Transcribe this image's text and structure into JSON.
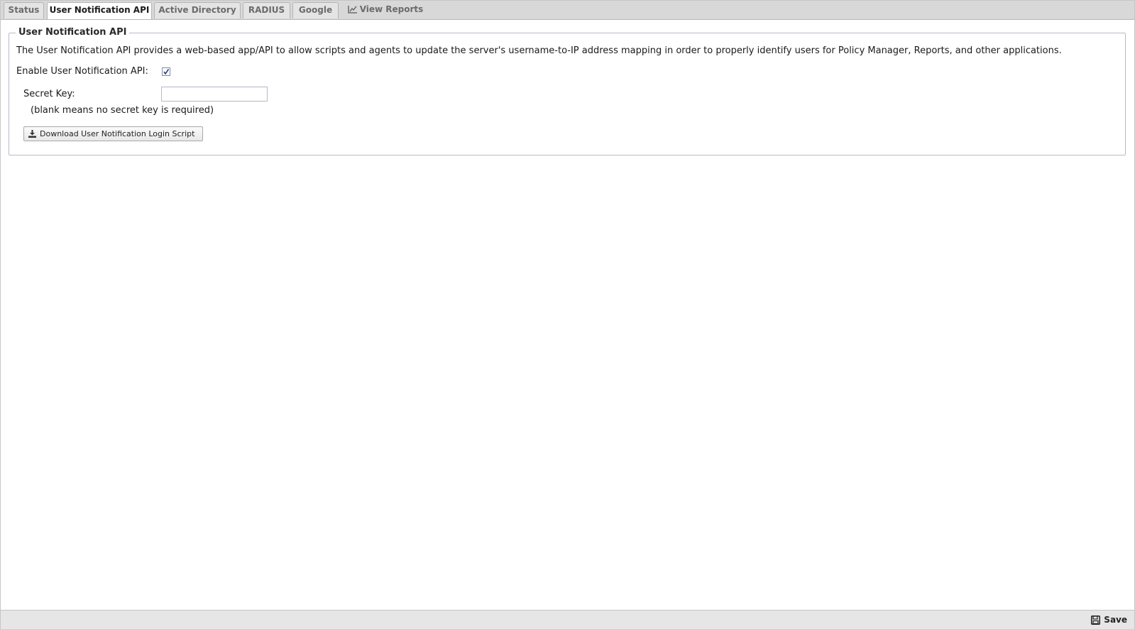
{
  "tabs": [
    {
      "label": "Status",
      "active": false
    },
    {
      "label": "User Notification API",
      "active": true
    },
    {
      "label": "Active Directory",
      "active": false
    },
    {
      "label": "RADIUS",
      "active": false
    },
    {
      "label": "Google",
      "active": false
    },
    {
      "label": "View Reports",
      "active": false,
      "icon": "chart-line-icon"
    }
  ],
  "section": {
    "legend": "User Notification API",
    "description": "The User Notification API provides a web-based app/API to allow scripts and agents to update the server's username-to-IP address mapping in order to properly identify users for Policy Manager, Reports, and other applications.",
    "enable_label": "Enable User Notification API:",
    "enable_checked": true,
    "secret_key_label": "Secret Key:",
    "secret_key_value": "",
    "secret_key_hint": "(blank means no secret key is required)",
    "download_button": {
      "label": "Download User Notification Login Script",
      "icon": "download-icon"
    }
  },
  "footer": {
    "save_label": "Save",
    "save_icon": "floppy-disk-icon"
  }
}
